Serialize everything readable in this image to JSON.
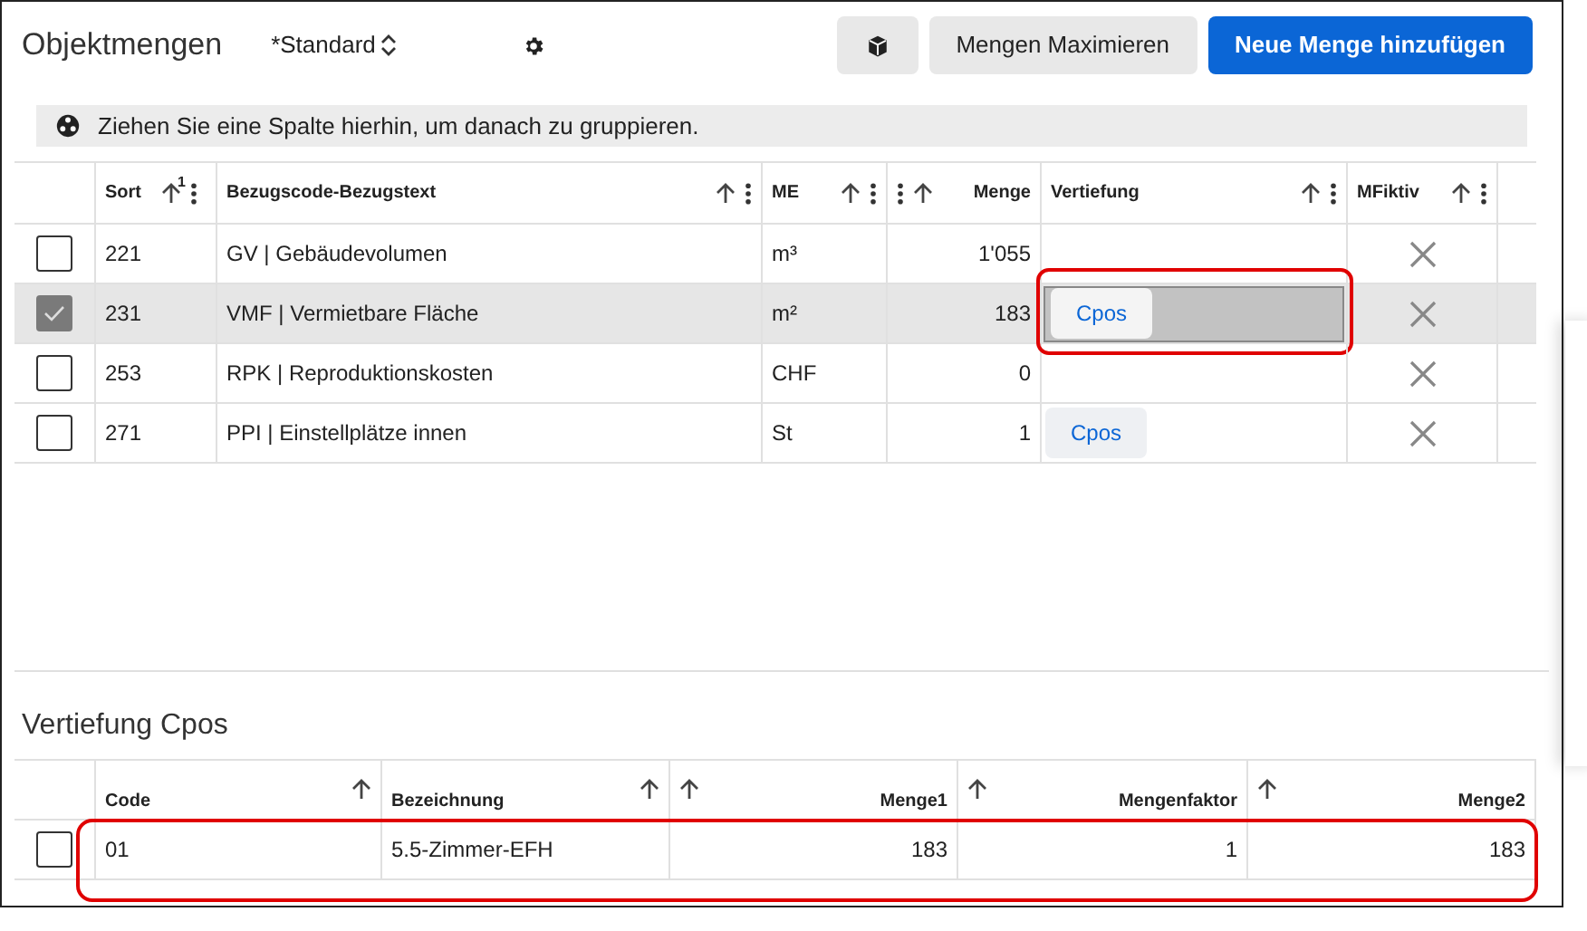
{
  "header": {
    "title": "Objektmengen",
    "view": "*Standard",
    "buttons": [
      {
        "kind": "icon"
      },
      {
        "kind": "secondary",
        "label": "Mengen Maximieren"
      },
      {
        "kind": "primary",
        "label": "Neue Menge hinzufügen"
      }
    ]
  },
  "group_bar": {
    "text": "Ziehen Sie eine Spalte hierhin, um danach zu gruppieren."
  },
  "table": {
    "columns": [
      {
        "label": "Sort",
        "kind": "text",
        "sort_index": "1"
      },
      {
        "label": "Bezugscode-Bezugstext",
        "kind": "text"
      },
      {
        "label": "ME",
        "kind": "text"
      },
      {
        "label": "Menge",
        "kind": "number"
      },
      {
        "label": "Vertiefung",
        "kind": "text"
      },
      {
        "label": "MFiktiv",
        "kind": "text"
      }
    ],
    "rows": [
      {
        "selected": false,
        "sort": "221",
        "text": "GV | Gebäudevolumen",
        "me": "m³",
        "menge": "1'055",
        "mfiktiv": false
      },
      {
        "selected": true,
        "sort": "231",
        "text": "VMF | Vermietbare Fläche",
        "me": "m²",
        "menge": "183",
        "vertiefung": {
          "label": "Cpos",
          "active": true,
          "highlighted": true
        },
        "mfiktiv": false
      },
      {
        "selected": false,
        "sort": "253",
        "text": "RPK | Reproduktionskosten",
        "me": "CHF",
        "menge": "0",
        "mfiktiv": false
      },
      {
        "selected": false,
        "sort": "271",
        "text": "PPI | Einstellplätze innen",
        "me": "St",
        "menge": "1",
        "vertiefung": {
          "label": "Cpos",
          "active": false
        },
        "mfiktiv": false
      }
    ]
  },
  "detail": {
    "title": "Vertiefung Cpos",
    "highlighted": true,
    "columns": [
      {
        "label": "Code",
        "kind": "text"
      },
      {
        "label": "Bezeichnung",
        "kind": "text"
      },
      {
        "label": "Menge1",
        "kind": "number"
      },
      {
        "label": "Mengenfaktor",
        "kind": "number"
      },
      {
        "label": "Menge2",
        "kind": "number"
      }
    ],
    "rows": [
      {
        "selected": false,
        "cells": [
          "01",
          "5.5-Zimmer-EFH",
          "183",
          "1",
          "183"
        ]
      }
    ]
  }
}
